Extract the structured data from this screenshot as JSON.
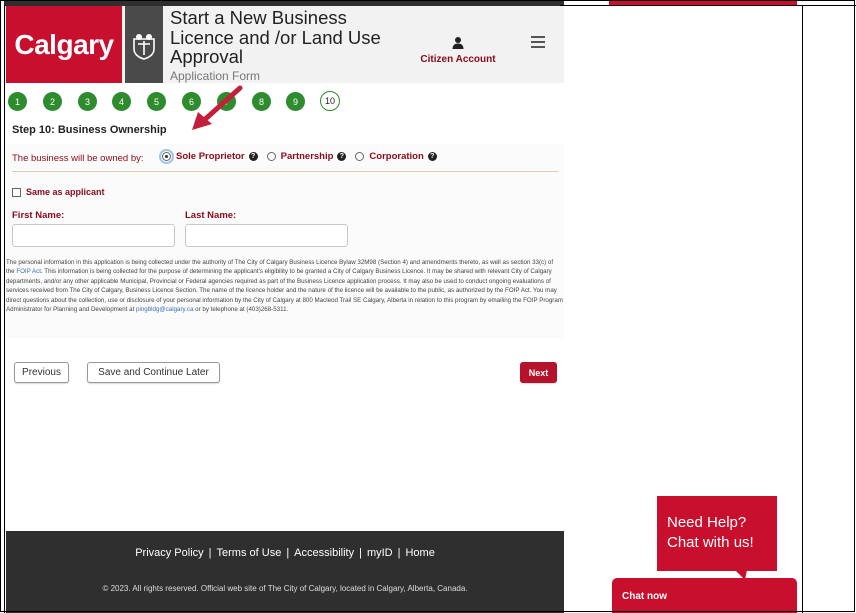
{
  "header": {
    "logo_text": "Calgary",
    "title": "Start a New Business Licence and /or Land Use Approval",
    "subtitle": "Application Form",
    "account_label": "Citizen Account",
    "icons": {
      "account": "user-icon",
      "menu": "hamburger-menu-icon",
      "crest": "city-crest-icon"
    }
  },
  "progress": {
    "steps": [
      "1",
      "2",
      "3",
      "4",
      "5",
      "6",
      "7",
      "8",
      "9",
      "10"
    ],
    "current": "10"
  },
  "step_title": "Step 10: Business Ownership",
  "ownership": {
    "label": "The business will be owned by:",
    "options": [
      {
        "label": "Sole Proprietor",
        "checked": true
      },
      {
        "label": "Partnership",
        "checked": false
      },
      {
        "label": "Corporation",
        "checked": false
      }
    ]
  },
  "same_as_applicant": {
    "label": "Same as applicant",
    "checked": false
  },
  "fields": {
    "first_name_label": "First Name:",
    "first_name_value": "",
    "last_name_label": "Last Name:",
    "last_name_value": ""
  },
  "foip": {
    "part1": "The personal information in this application is being collected under the authority of The City of Calgary Business Licence Bylaw 32M98 (Section 4) and amendments thereto, as well as section 33(c) of the ",
    "link1": "FOIP Act",
    "part2": ". This information is being collected for the purpose of determining the applicant's eligibility to be granted a City of Calgary Business Licence. It may be shared with relevant City of Calgary departments, and/or any other applicable Municipal, Provincial or Federal agencies required as part of the Business Licence application process. It may also be used to conduct ongoing evaluations of services received from The City of Calgary, Business Licence Section. The name of the licence holder and the nature of the licence will be available to the public, as authorized by the FOIP Act. You may direct questions about the collection, use or disclosure of your personal information by the City of Calgary at 800 Macleod Trail SE Calgary, Alberta in relation to this program by emailing the FOIP Program Administrator for Planning and Development at ",
    "link2": "pingbldg@calgary.ca",
    "part3": " or by telephone at (403)268-5311."
  },
  "buttons": {
    "previous": "Previous",
    "save": "Save and Continue Later",
    "next": "Next"
  },
  "footer": {
    "links": [
      "Privacy Policy",
      "Terms of Use",
      "Accessibility",
      "myID",
      "Home"
    ],
    "separator": "|",
    "copyright": "© 2023. All rights reserved. Official web site of The City of Calgary, located in Calgary, Alberta, Canada."
  },
  "chat": {
    "bubble_line1": "Need Help?",
    "bubble_line2": "Chat with us!",
    "tab_label": "Chat now"
  },
  "colors": {
    "brand_red": "#c8102e",
    "step_green": "#2e8b2e",
    "label_red": "#8b0a1a"
  }
}
